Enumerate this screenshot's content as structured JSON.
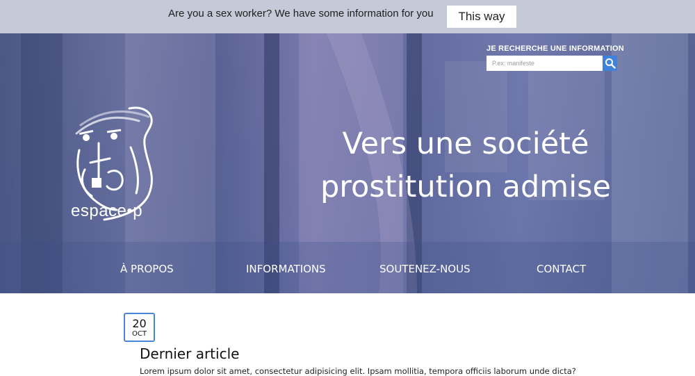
{
  "topbar": {
    "message": "Are you a sex worker? We have some information for you",
    "button_label": "This way"
  },
  "search": {
    "label": "JE RECHERCHE UNE INFORMATION",
    "placeholder": "P.ex: manifeste",
    "icon": "search-icon"
  },
  "logo": {
    "text": "espace•p"
  },
  "tagline": {
    "line1": "Vers une société",
    "line2": "prostitution admise"
  },
  "nav": {
    "items": [
      {
        "label": "À PROPOS"
      },
      {
        "label": "INFORMATIONS"
      },
      {
        "label": "SOUTENEZ-NOUS"
      },
      {
        "label": "CONTACT"
      }
    ]
  },
  "article": {
    "date_day": "20",
    "date_month": "OCT",
    "title": "Dernier article",
    "excerpt": "Lorem ipsum dolor sit amet, consectetur adipisicing elit. Ipsam mollitia, tempora officiis laborum unde dicta?"
  },
  "colors": {
    "topbar_bg": "#c4cad8",
    "accent": "#3e82d9",
    "hero_tint": "#6f76a3"
  }
}
